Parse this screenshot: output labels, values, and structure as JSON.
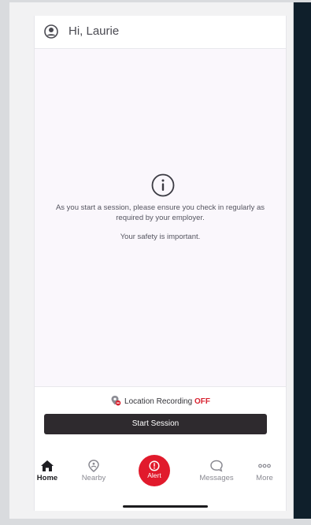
{
  "header": {
    "greeting": "Hi, Laurie",
    "avatar_icon": "user-circle-icon"
  },
  "main": {
    "info_icon": "info-circle-icon",
    "message": "As you start a session, please ensure you check in regularly as required by your employer.",
    "safety_message": "Your safety is important."
  },
  "location": {
    "icon": "location-off-icon",
    "label": "Location Recording",
    "status": "OFF",
    "status_color": "#d8222f"
  },
  "start_button": {
    "label": "Start Session",
    "color": "#2e2a2e"
  },
  "tabbar": {
    "items": [
      {
        "label": "Home",
        "icon": "home-icon",
        "active": true
      },
      {
        "label": "Nearby",
        "icon": "nearby-pin-icon",
        "active": false
      },
      {
        "label": "Alert",
        "icon": "alert-icon",
        "active": false
      },
      {
        "label": "Messages",
        "icon": "message-bubble-icon",
        "active": false
      },
      {
        "label": "More",
        "icon": "more-dots-icon",
        "active": false
      }
    ],
    "alert_color": "#e11a2c"
  }
}
